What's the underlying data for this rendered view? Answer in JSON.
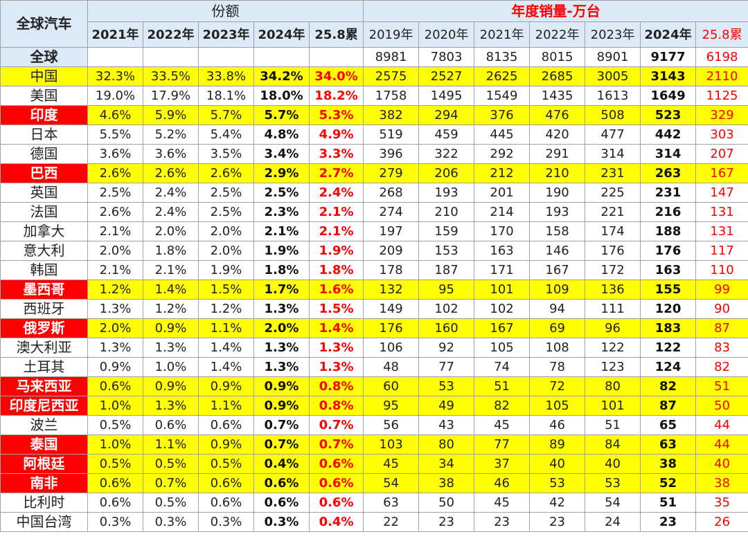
{
  "header": {
    "corner": "全球汽车",
    "share_title": "份额",
    "sales_title": "年度销量-万台",
    "share_years": [
      "2021年",
      "2022年",
      "2023年",
      "2024年",
      "25.8累"
    ],
    "sales_years": [
      "2019年",
      "2020年",
      "2021年",
      "2022年",
      "2023年",
      "2024年",
      "25.8累"
    ]
  },
  "rows": [
    {
      "name": "全球",
      "share": [
        "",
        "",
        "",
        "",
        ""
      ],
      "sales": [
        "8981",
        "7803",
        "8135",
        "8015",
        "8901",
        "9177",
        "6198"
      ]
    },
    {
      "name": "中国",
      "share": [
        "32.3%",
        "33.5%",
        "33.8%",
        "34.2%",
        "34.0%"
      ],
      "sales": [
        "2575",
        "2527",
        "2625",
        "2685",
        "3005",
        "3143",
        "2110"
      ]
    },
    {
      "name": "美国",
      "share": [
        "19.0%",
        "17.9%",
        "18.1%",
        "18.0%",
        "18.2%"
      ],
      "sales": [
        "1758",
        "1495",
        "1549",
        "1435",
        "1613",
        "1649",
        "1125"
      ]
    },
    {
      "name": "印度",
      "share": [
        "4.6%",
        "5.9%",
        "5.7%",
        "5.7%",
        "5.3%"
      ],
      "sales": [
        "382",
        "294",
        "376",
        "476",
        "508",
        "523",
        "329"
      ]
    },
    {
      "name": "日本",
      "share": [
        "5.5%",
        "5.2%",
        "5.4%",
        "4.8%",
        "4.9%"
      ],
      "sales": [
        "519",
        "459",
        "445",
        "420",
        "477",
        "442",
        "303"
      ]
    },
    {
      "name": "德国",
      "share": [
        "3.6%",
        "3.6%",
        "3.5%",
        "3.4%",
        "3.3%"
      ],
      "sales": [
        "396",
        "322",
        "292",
        "291",
        "314",
        "314",
        "207"
      ]
    },
    {
      "name": "巴西",
      "share": [
        "2.6%",
        "2.6%",
        "2.6%",
        "2.9%",
        "2.7%"
      ],
      "sales": [
        "279",
        "206",
        "212",
        "210",
        "231",
        "263",
        "167"
      ]
    },
    {
      "name": "英国",
      "share": [
        "2.5%",
        "2.4%",
        "2.5%",
        "2.5%",
        "2.4%"
      ],
      "sales": [
        "268",
        "193",
        "201",
        "190",
        "225",
        "231",
        "147"
      ]
    },
    {
      "name": "法国",
      "share": [
        "2.6%",
        "2.4%",
        "2.5%",
        "2.3%",
        "2.1%"
      ],
      "sales": [
        "274",
        "210",
        "214",
        "193",
        "221",
        "216",
        "131"
      ]
    },
    {
      "name": "加拿大",
      "share": [
        "2.1%",
        "2.0%",
        "2.0%",
        "2.1%",
        "2.1%"
      ],
      "sales": [
        "197",
        "159",
        "170",
        "158",
        "174",
        "188",
        "131"
      ]
    },
    {
      "name": "意大利",
      "share": [
        "2.0%",
        "1.8%",
        "2.0%",
        "1.9%",
        "1.9%"
      ],
      "sales": [
        "209",
        "153",
        "163",
        "146",
        "176",
        "176",
        "117"
      ]
    },
    {
      "name": "韩国",
      "share": [
        "2.1%",
        "2.1%",
        "1.9%",
        "1.8%",
        "1.8%"
      ],
      "sales": [
        "178",
        "187",
        "171",
        "167",
        "172",
        "163",
        "110"
      ]
    },
    {
      "name": "墨西哥",
      "share": [
        "1.2%",
        "1.4%",
        "1.5%",
        "1.7%",
        "1.6%"
      ],
      "sales": [
        "132",
        "95",
        "101",
        "109",
        "136",
        "155",
        "99"
      ]
    },
    {
      "name": "西班牙",
      "share": [
        "1.3%",
        "1.2%",
        "1.2%",
        "1.3%",
        "1.5%"
      ],
      "sales": [
        "149",
        "102",
        "102",
        "94",
        "111",
        "120",
        "90"
      ]
    },
    {
      "name": "俄罗斯",
      "share": [
        "2.0%",
        "0.9%",
        "1.1%",
        "2.0%",
        "1.4%"
      ],
      "sales": [
        "176",
        "160",
        "167",
        "69",
        "96",
        "183",
        "87"
      ]
    },
    {
      "name": "澳大利亚",
      "share": [
        "1.3%",
        "1.3%",
        "1.4%",
        "1.3%",
        "1.3%"
      ],
      "sales": [
        "106",
        "92",
        "105",
        "108",
        "122",
        "122",
        "83"
      ]
    },
    {
      "name": "土耳其",
      "share": [
        "0.9%",
        "1.0%",
        "1.4%",
        "1.3%",
        "1.3%"
      ],
      "sales": [
        "48",
        "77",
        "74",
        "78",
        "123",
        "124",
        "82"
      ]
    },
    {
      "name": "马来西亚",
      "share": [
        "0.6%",
        "0.9%",
        "0.9%",
        "0.9%",
        "0.8%"
      ],
      "sales": [
        "60",
        "53",
        "51",
        "72",
        "80",
        "82",
        "51"
      ]
    },
    {
      "name": "印度尼西亚",
      "share": [
        "1.0%",
        "1.3%",
        "1.1%",
        "0.9%",
        "0.8%"
      ],
      "sales": [
        "95",
        "49",
        "82",
        "105",
        "101",
        "87",
        "50"
      ]
    },
    {
      "name": "波兰",
      "share": [
        "0.5%",
        "0.6%",
        "0.6%",
        "0.7%",
        "0.7%"
      ],
      "sales": [
        "56",
        "43",
        "45",
        "46",
        "51",
        "65",
        "44"
      ]
    },
    {
      "name": "泰国",
      "share": [
        "1.0%",
        "1.1%",
        "0.9%",
        "0.7%",
        "0.7%"
      ],
      "sales": [
        "103",
        "80",
        "77",
        "89",
        "84",
        "63",
        "44"
      ]
    },
    {
      "name": "阿根廷",
      "share": [
        "0.5%",
        "0.5%",
        "0.5%",
        "0.4%",
        "0.6%"
      ],
      "sales": [
        "45",
        "34",
        "37",
        "40",
        "40",
        "38",
        "40"
      ]
    },
    {
      "name": "南非",
      "share": [
        "0.6%",
        "0.7%",
        "0.6%",
        "0.6%",
        "0.6%"
      ],
      "sales": [
        "54",
        "38",
        "46",
        "53",
        "53",
        "52",
        "38"
      ]
    },
    {
      "name": "比利时",
      "share": [
        "0.6%",
        "0.5%",
        "0.6%",
        "0.6%",
        "0.6%"
      ],
      "sales": [
        "63",
        "50",
        "45",
        "42",
        "54",
        "51",
        "35"
      ]
    },
    {
      "name": "中国台湾",
      "share": [
        "0.3%",
        "0.3%",
        "0.3%",
        "0.3%",
        "0.4%"
      ],
      "sales": [
        "22",
        "23",
        "23",
        "23",
        "24",
        "23",
        "26"
      ]
    }
  ],
  "colors": {
    "header_bg": "#dce9f7",
    "row_highlight": "#ffff00",
    "name_highlight": "#ff0000",
    "accent_text": "#ff0000"
  }
}
